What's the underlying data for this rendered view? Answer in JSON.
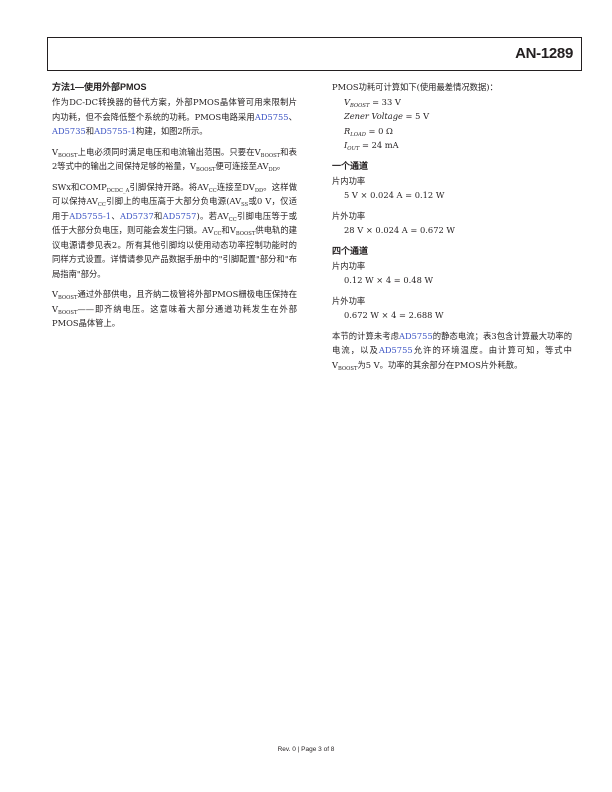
{
  "header": {
    "doc_id": "AN-1289"
  },
  "left": {
    "heading": "方法1—使用外部PMOS",
    "p1": {
      "a": "作为DC-DC转换器的替代方案，外部PMOS晶体管可用来限制片内功耗，但不会降低整个系统的功耗。PMOS电路采用",
      "l1": "AD5755",
      "b": "、",
      "l2": "AD5735",
      "c": "和",
      "l3": "AD5755-1",
      "d": "构建，如图2所示。"
    },
    "p2": {
      "v1": "V",
      "s1": "BOOST",
      "a": "上电必须同时满足电压和电流输出范围。只要在",
      "v2": "V",
      "s2": "BOOST",
      "b": "和表2等式中的输出之间保持足够的裕量，V",
      "s3": "BOOST",
      "c": "便可连接至AV",
      "s4": "DD",
      "d": "。"
    },
    "p3": {
      "a": "SWx和COMP",
      "s1": "DCDC_A",
      "b": "引脚保持开路。将AV",
      "s2": "CC",
      "c": "连接至DV",
      "s3": "DD",
      "d": "。这样做可以保持AV",
      "s4": "CC",
      "e": "引脚上的电压高于大部分负电源(AV",
      "s5": "SS",
      "f": "或0 V，仅适用于",
      "l1": "AD5755-1",
      "g": "、",
      "l2": "AD5737",
      "h": "和",
      "l3": "AD5757",
      "i": ")。若AV",
      "s6": "CC",
      "j": "引脚电压等于或低于大部分负电压，则可能会发生闩锁。AV",
      "s7": "CC",
      "k": "和V",
      "s8": "BOOST",
      "l": "供电轨的建议电源请参见表2。所有其他引脚均以使用动态功率控制功能时的同样方式设置。详情请参见产品数据手册中的\"引脚配置\"部分和\"布局指南\"部分。"
    },
    "p4": {
      "a": "V",
      "s1": "BOOST",
      "b": "通过外部供电，且齐纳二极管将外部PMOS栅极电压保持在V",
      "s2": "BOOST",
      "c": "——即齐纳电压。这意味着大部分通道功耗发生在外部PMOS晶体管上。"
    }
  },
  "right": {
    "intro": "PMOS功耗可计算如下(使用最差情况数据)：",
    "params": [
      {
        "v": "V",
        "sub": "BOOST",
        "val": " = 33 V"
      },
      {
        "v": "Zener Voltage",
        "sub": "",
        "val": " = 5 V"
      },
      {
        "v": "R",
        "sub": "LOAD",
        "val": " = 0 Ω"
      },
      {
        "v": "I",
        "sub": "OUT",
        "val": " = 24 mA"
      }
    ],
    "one_ch_heading": "一个通道",
    "onchip_label": "片内功率",
    "onchip1": "5 V × 0.024 A = 0.12 W",
    "offchip_label": "片外功率",
    "offchip1": "28 V × 0.024 A = 0.672 W",
    "four_ch_heading": "四个通道",
    "onchip4": "0.12 W × 4 = 0.48 W",
    "offchip4": "0.672 W × 4 = 2.688 W",
    "summary": {
      "a": "本节的计算未考虑",
      "l1": "AD5755",
      "b": "的静态电流；表3包含计算最大功率的电流，以及",
      "l2": "AD5755",
      "c": "允许的环境温度。由计算可知，等式中V",
      "s1": "BOOST",
      "d": "为5 V。功率的其余部分在PMOS片外耗散。"
    }
  },
  "footer": {
    "text": "Rev. 0 | Page 3 of 8"
  },
  "colors": {
    "text": "#231f20",
    "link": "#3b53c4"
  }
}
